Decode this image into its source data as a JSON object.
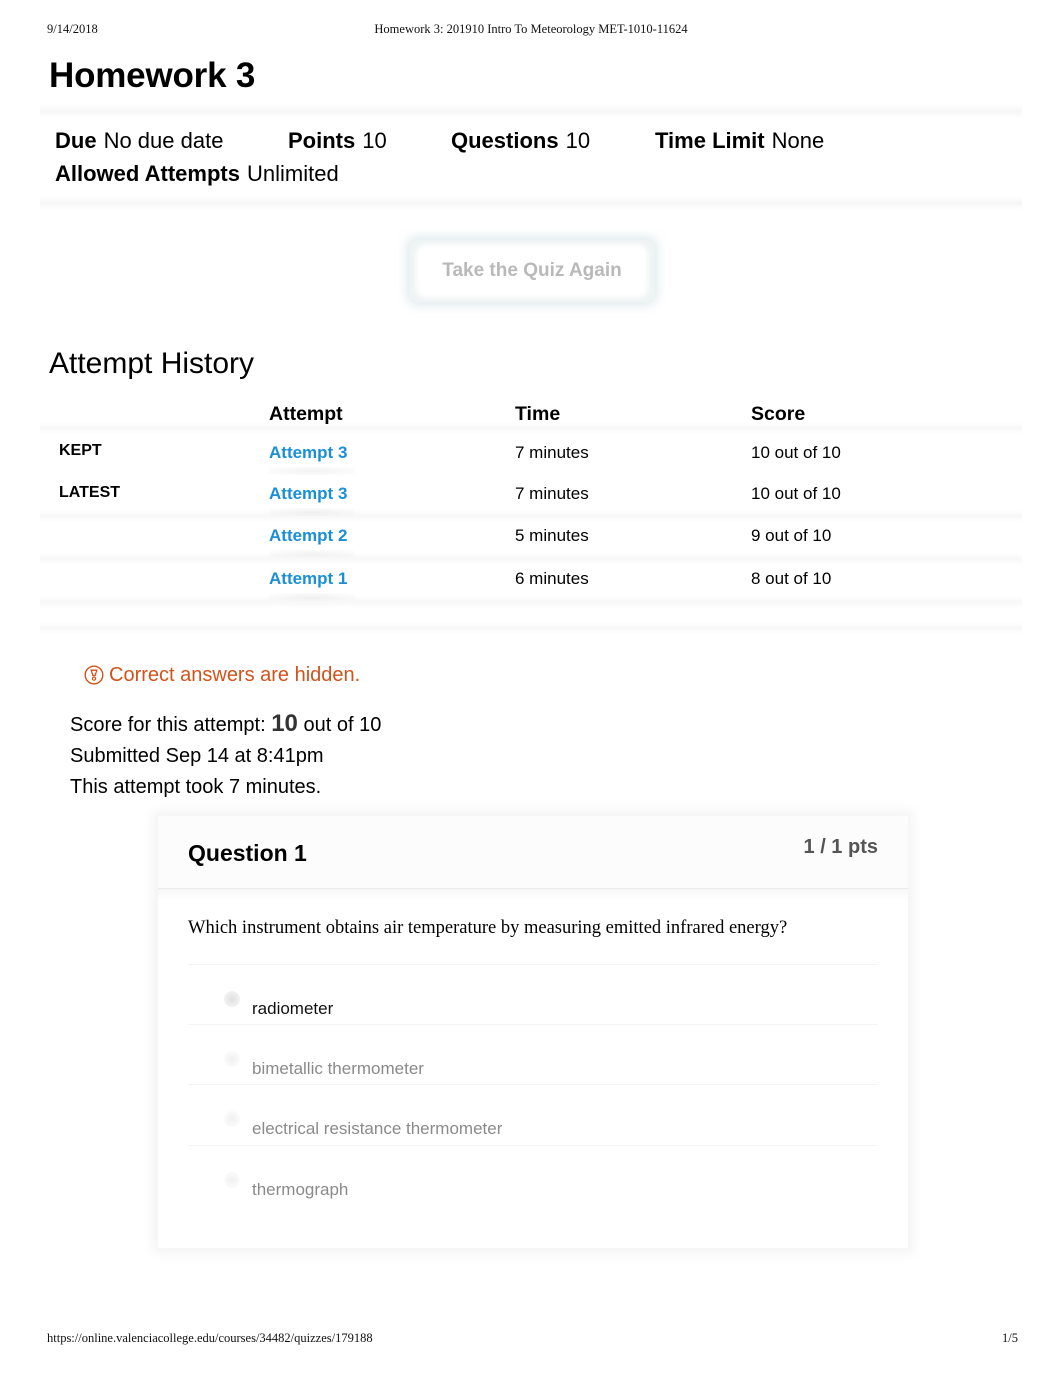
{
  "print_header": {
    "date": "9/14/2018",
    "title": "Homework 3: 201910 Intro To Meteorology MET-1010-11624"
  },
  "page_title": "Homework 3",
  "details": [
    {
      "label": "Due",
      "value": "No due date"
    },
    {
      "label": "Points",
      "value": "10"
    },
    {
      "label": "Questions",
      "value": "10"
    },
    {
      "label": "Time Limit",
      "value": "None"
    },
    {
      "label": "Allowed Attempts",
      "value": "Unlimited"
    }
  ],
  "take_quiz_button": "Take the Quiz Again",
  "attempt_history": {
    "title": "Attempt History",
    "columns": [
      "",
      "Attempt",
      "Time",
      "Score"
    ],
    "rows": [
      {
        "badge": "KEPT",
        "attempt": "Attempt 3",
        "time": "7 minutes",
        "score": "10 out of 10"
      },
      {
        "badge": "LATEST",
        "attempt": "Attempt 3",
        "time": "7 minutes",
        "score": "10 out of 10"
      },
      {
        "badge": "",
        "attempt": "Attempt 2",
        "time": "5 minutes",
        "score": "9 out of 10"
      },
      {
        "badge": "",
        "attempt": "Attempt 1",
        "time": "6 minutes",
        "score": "8 out of 10"
      }
    ]
  },
  "notice": {
    "icon": "warning-bulb-icon",
    "text": "Correct answers are hidden.",
    "color": "#d1521a"
  },
  "attempt_summary": {
    "score_prefix": "Score for this attempt:",
    "score": "10",
    "score_suffix": "out of 10",
    "submitted": "Submitted Sep 14 at 8:41pm",
    "duration": "This attempt took 7 minutes."
  },
  "question": {
    "title": "Question 1",
    "points": "1 / 1 pts",
    "text": "Which instrument obtains air temperature by measuring emitted infrared energy?",
    "answers": [
      {
        "text": "radiometer",
        "selected": true
      },
      {
        "text": "bimetallic thermometer",
        "selected": false
      },
      {
        "text": "electrical resistance thermometer",
        "selected": false
      },
      {
        "text": "thermograph",
        "selected": false
      }
    ]
  },
  "print_footer": {
    "url": "https://online.valenciacollege.edu/courses/34482/quizzes/179188",
    "page": "1/5"
  },
  "colors": {
    "link": "#1a8fd6",
    "notice": "#d1521a",
    "button_text": "#b9b9b9"
  }
}
